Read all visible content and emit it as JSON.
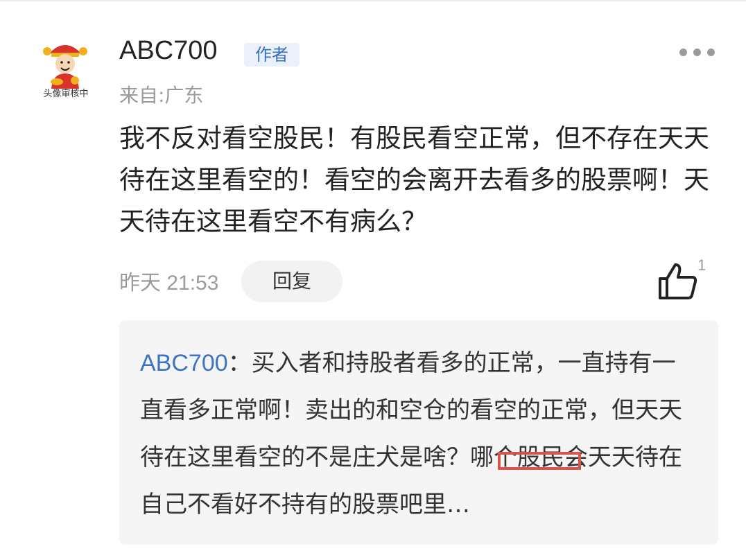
{
  "comment": {
    "avatar_caption": "头像审核中",
    "username": "ABC700",
    "author_badge": "作者",
    "location": "来自:广东",
    "text": "我不反对看空股民！有股民看空正常，但不存在天天待在这里看空的！看空的会离开去看多的股票啊！天天待在这里看空不有病么？",
    "timestamp": "昨天 21:53",
    "reply_label": "回复",
    "like_count": "1"
  },
  "reply": {
    "author": "ABC700",
    "separator": "：",
    "text": "买入者和持股者看多的正常，一直持有一直看多正常啊！卖出的和空仓的看空的正常，但天天待在这里看空的不是庄犬是啥？哪个股民会天天待在自己不看好不持有的股票吧里…"
  },
  "colors": {
    "author_link": "#3b74c4",
    "badge_bg": "#eaf1fb",
    "highlight_border": "#d9534f"
  },
  "icons": {
    "more": "more-dots-icon",
    "like": "thumbs-up-icon"
  }
}
